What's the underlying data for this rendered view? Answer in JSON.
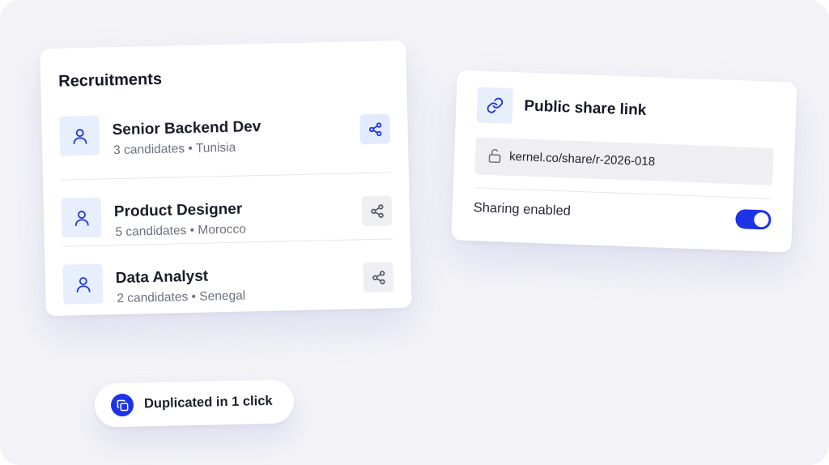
{
  "recruitments": {
    "title": "Recruitments",
    "items": [
      {
        "name": "Senior Backend Dev",
        "candidates": "3 candidates",
        "separator": "•",
        "location": "Tunisia",
        "share_active": true
      },
      {
        "name": "Product Designer",
        "candidates": "5 candidates",
        "separator": "•",
        "location": "Morocco",
        "share_active": false
      },
      {
        "name": "Data Analyst",
        "candidates": "2 candidates",
        "separator": "•",
        "location": "Senegal",
        "share_active": false
      }
    ],
    "icons": {
      "row": "user-icon",
      "action": "share-icon"
    }
  },
  "share_link": {
    "title": "Public share link",
    "icon": "link-icon",
    "url": "kernel.co/share/r-2026-018",
    "url_icon": "unlock-icon",
    "toggle_label": "Sharing enabled",
    "toggle_on": true
  },
  "toast": {
    "text": "Duplicated in 1 click",
    "icon": "copy-icon"
  },
  "colors": {
    "accent": "#1d33e6",
    "accent_soft": "#e7eefc",
    "background": "#f3f3f7",
    "muted_text": "#6e7080"
  }
}
